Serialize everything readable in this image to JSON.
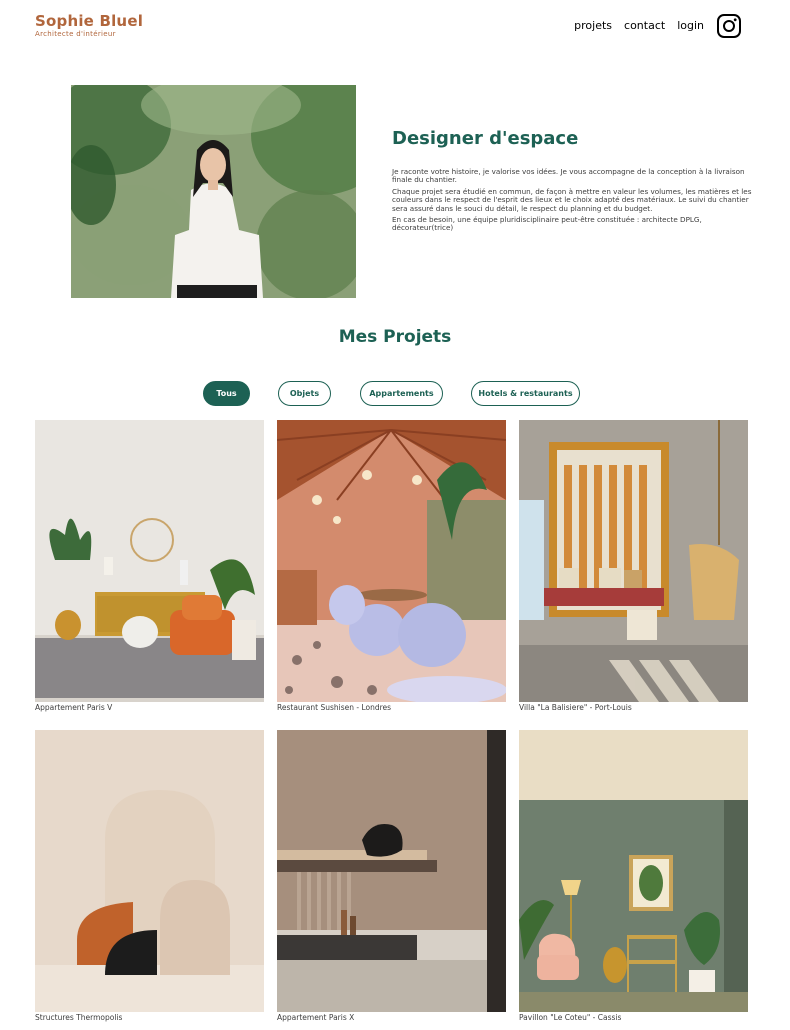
{
  "header": {
    "logo_name": "Sophie Bluel",
    "logo_subtitle": "Architecte d'intérieur",
    "nav": [
      "projets",
      "contact",
      "login"
    ],
    "instagram_icon": "instagram-icon"
  },
  "intro": {
    "title": "Designer d'espace",
    "paragraphs": [
      "Je raconte votre histoire, je valorise vos idées. Je vous accompagne de la conception à la livraison finale du chantier.",
      "Chaque projet sera étudié en commun, de façon à mettre en valeur les volumes, les matières et les couleurs dans le respect de l'esprit des lieux et le choix adapté des matériaux. Le suivi du chantier sera assuré dans le souci du détail, le respect du planning et du budget.",
      "En cas de besoin, une équipe pluridisciplinaire peut-être constituée : architecte DPLG, décorateur(trice)"
    ]
  },
  "projects": {
    "title": "Mes Projets",
    "filters": [
      {
        "label": "Tous",
        "active": true
      },
      {
        "label": "Objets",
        "active": false
      },
      {
        "label": "Appartements",
        "active": false
      },
      {
        "label": "Hotels & restaurants",
        "active": false
      }
    ],
    "items": [
      {
        "caption": "Appartement Paris V"
      },
      {
        "caption": "Restaurant Sushisen - Londres"
      },
      {
        "caption": "Villa \"La Balisiere\" - Port-Louis"
      },
      {
        "caption": "Structures Thermopolis"
      },
      {
        "caption": "Appartement Paris X"
      },
      {
        "caption": "Pavillon \"Le Coteu\" - Cassis"
      }
    ]
  },
  "colors": {
    "brand": "#B1663C",
    "accent": "#1D6154",
    "text": "#3d3d3d"
  }
}
